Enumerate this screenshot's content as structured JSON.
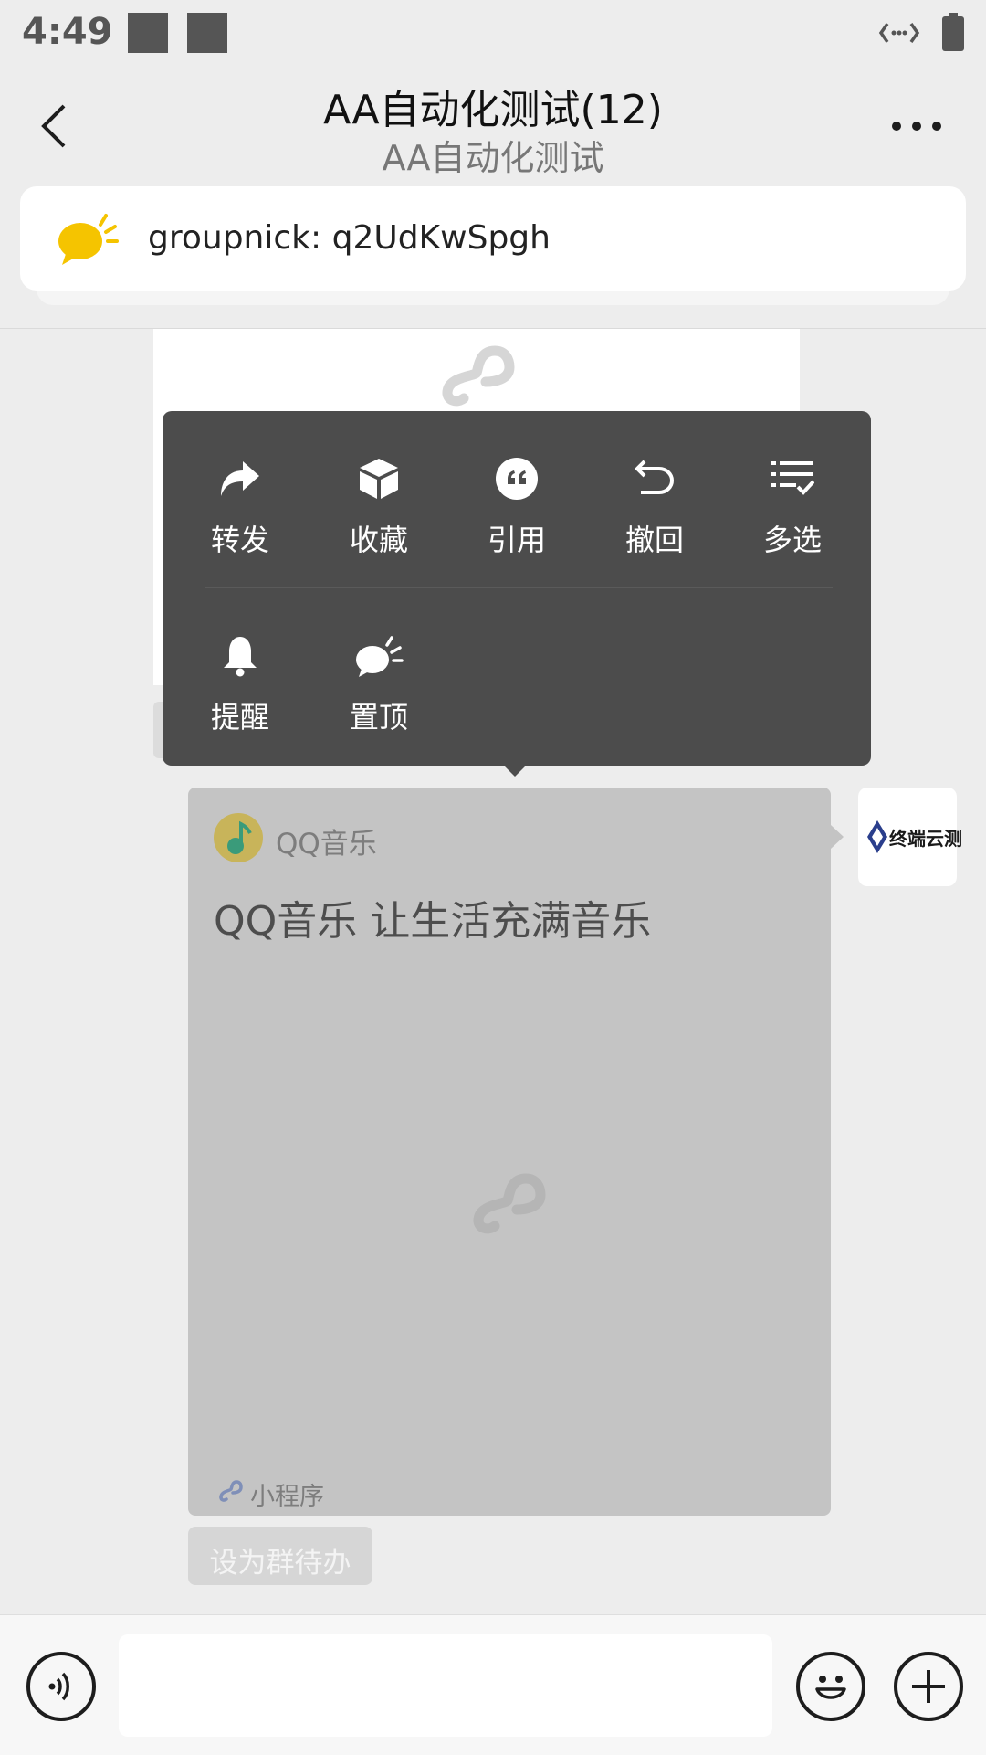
{
  "status_bar": {
    "time": "4:49"
  },
  "header": {
    "title": "AA自动化测试(12)",
    "subtitle": "AA自动化测试"
  },
  "nick_banner": {
    "text": "groupnick: q2UdKwSpgh"
  },
  "context_menu": {
    "row1": [
      {
        "label": "转发",
        "icon": "forward-icon"
      },
      {
        "label": "收藏",
        "icon": "favorite-box-icon"
      },
      {
        "label": "引用",
        "icon": "quote-icon"
      },
      {
        "label": "撤回",
        "icon": "undo-icon"
      },
      {
        "label": "多选",
        "icon": "multi-select-icon"
      }
    ],
    "row2": [
      {
        "label": "提醒",
        "icon": "bell-icon"
      },
      {
        "label": "置顶",
        "icon": "pin-top-icon"
      }
    ]
  },
  "message": {
    "app_name": "QQ音乐",
    "description": "QQ音乐 让生活充满音乐",
    "footer_label": "小程序",
    "avatar_text": "终端云测",
    "todo_label": "设为群待办"
  },
  "colors": {
    "menu_bg": "#4c4c4c",
    "card_bg": "#c4c4c4",
    "accent_yellow": "#f5c400"
  }
}
